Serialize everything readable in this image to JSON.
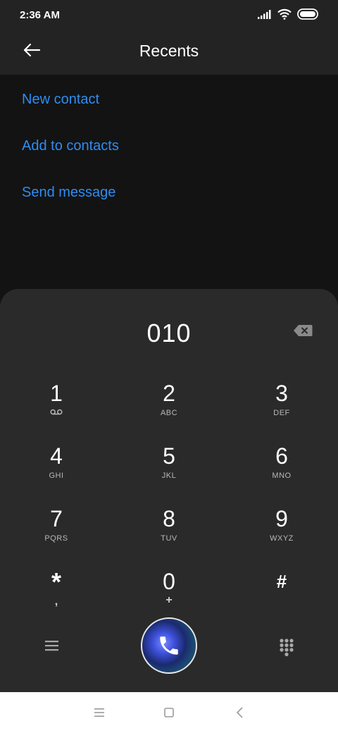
{
  "status": {
    "time": "2:36 AM"
  },
  "header": {
    "title": "Recents"
  },
  "actions": [
    "New contact",
    "Add to contacts",
    "Send message"
  ],
  "dialer": {
    "number": "010",
    "keys": [
      {
        "digit": "1",
        "letters": ""
      },
      {
        "digit": "2",
        "letters": "ABC"
      },
      {
        "digit": "3",
        "letters": "DEF"
      },
      {
        "digit": "4",
        "letters": "GHI"
      },
      {
        "digit": "5",
        "letters": "JKL"
      },
      {
        "digit": "6",
        "letters": "MNO"
      },
      {
        "digit": "7",
        "letters": "PQRS"
      },
      {
        "digit": "8",
        "letters": "TUV"
      },
      {
        "digit": "9",
        "letters": "WXYZ"
      },
      {
        "digit": "*",
        "letters": ","
      },
      {
        "digit": "0",
        "letters": "+"
      },
      {
        "digit": "#",
        "letters": ""
      }
    ]
  },
  "icons": {
    "back": "arrow-left-icon",
    "backspace": "backspace-icon",
    "voicemail": "voicemail-icon",
    "menu": "menu-icon",
    "call": "phone-icon",
    "dialpad": "dialpad-icon"
  },
  "colors": {
    "accent": "#2e8df2",
    "sheet": "#2a2a2a",
    "background": "#131313"
  }
}
